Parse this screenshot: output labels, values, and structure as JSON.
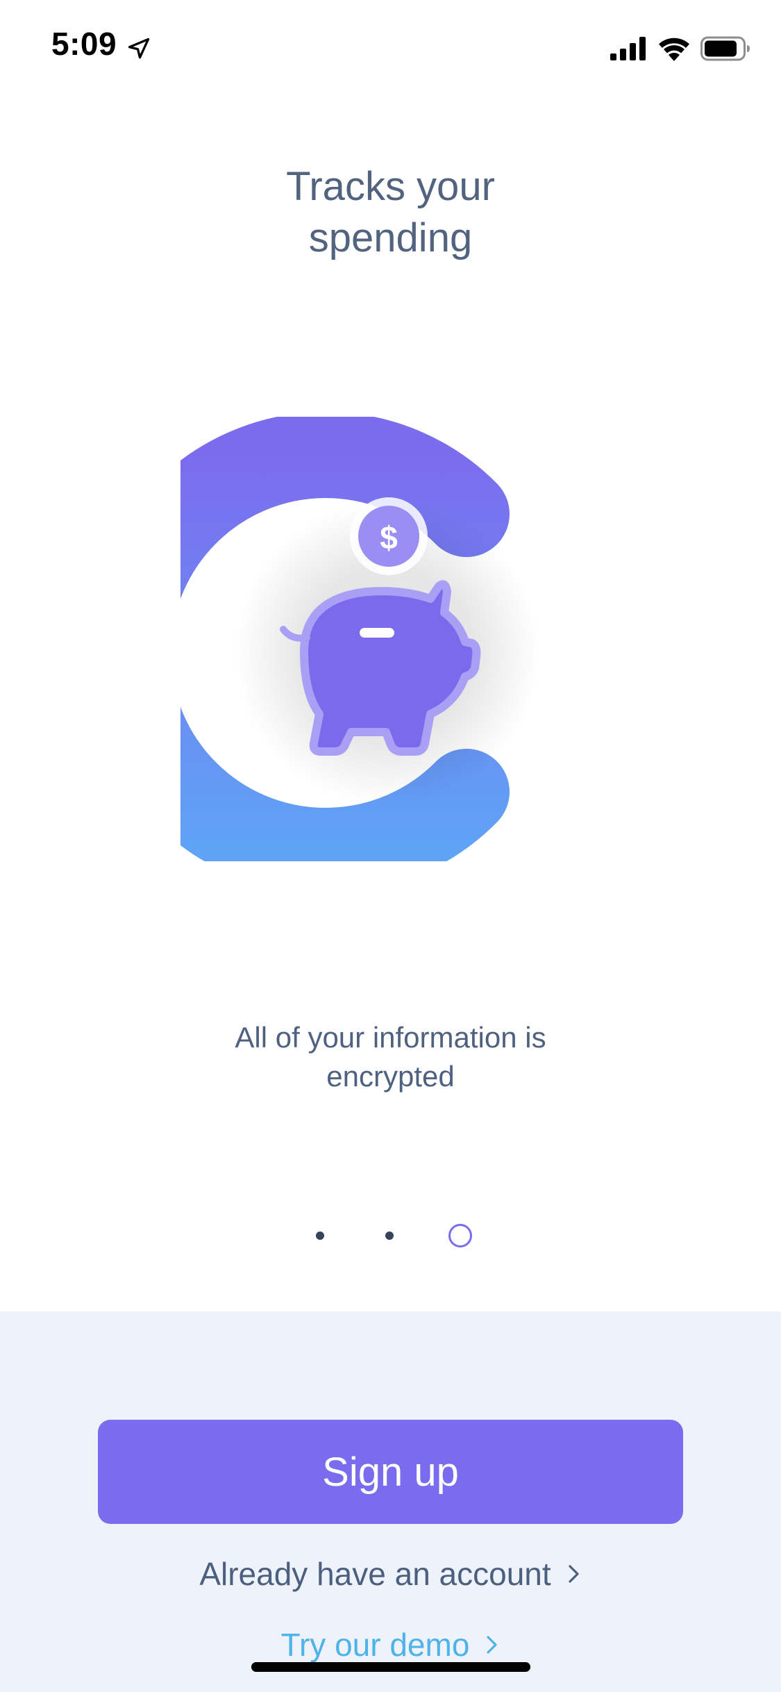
{
  "status_bar": {
    "time": "5:09",
    "icons": [
      "location-arrow-icon",
      "signal-icon",
      "wifi-icon",
      "battery-icon"
    ]
  },
  "onboarding": {
    "title_line1": "Tracks your",
    "title_line2": "spending",
    "illustration": "piggy-bank-with-coin-icon",
    "caption_line1": "All of your information is",
    "caption_line2": "encrypted",
    "pager": {
      "total": 3,
      "active_index": 2
    }
  },
  "actions": {
    "signup_label": "Sign up",
    "login_label": "Already have an account",
    "demo_label": "Try our demo"
  },
  "colors": {
    "accent": "#7a6cee",
    "text": "#51637f",
    "link": "#4fb2e8",
    "panel": "#eef3fb",
    "gradient_top": "#7b6cee",
    "gradient_bottom": "#5fa3f5"
  }
}
